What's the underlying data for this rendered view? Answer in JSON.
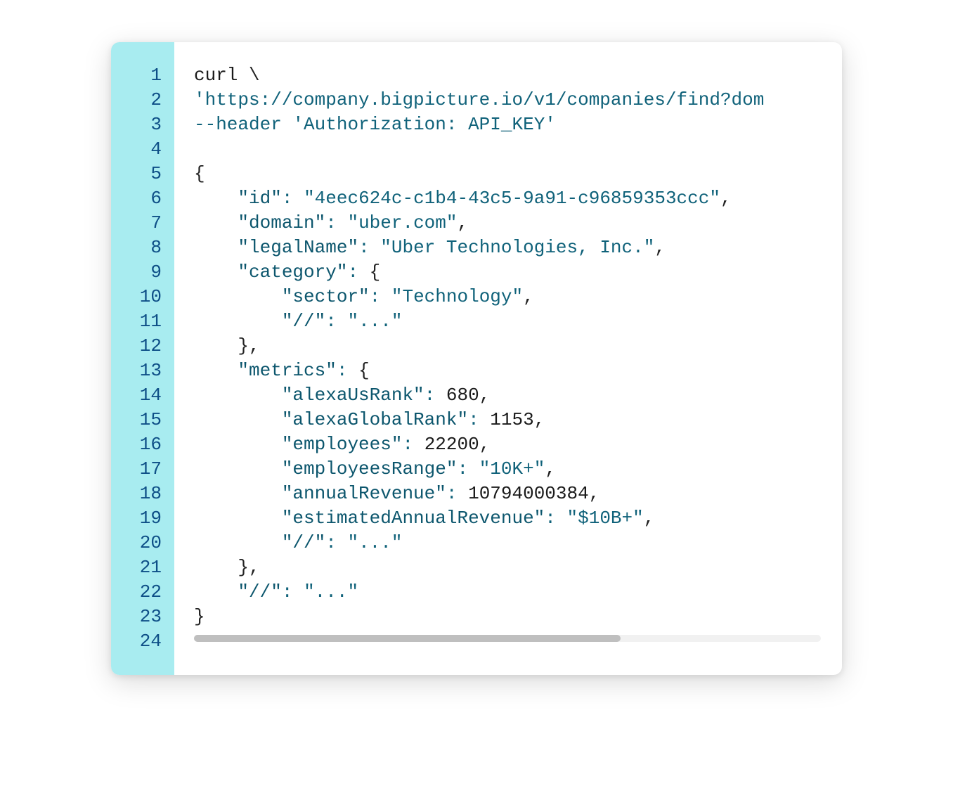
{
  "lineCount": 24,
  "scrollbar": {
    "thumbWidthPercent": "68%"
  },
  "code": {
    "l1": {
      "cmd": "curl",
      "bs": "\\"
    },
    "l2": {
      "url": "'https://company.bigpicture.io/v1/companies/find?dom"
    },
    "l3": {
      "opt": "--header",
      "arg": "'Authorization: API_KEY'"
    },
    "l4": {
      "blank": ""
    },
    "l5": {
      "open": "{"
    },
    "l6": {
      "key": "\"id\"",
      "colon": ":",
      "val": "\"4eec624c-c1b4-43c5-9a91-c96859353ccc\"",
      "comma": ","
    },
    "l7": {
      "key": "\"domain\"",
      "colon": ":",
      "val": "\"uber.com\"",
      "comma": ","
    },
    "l8": {
      "key": "\"legalName\"",
      "colon": ":",
      "val": "\"Uber Technologies, Inc.\"",
      "comma": ","
    },
    "l9": {
      "key": "\"category\"",
      "colon": ":",
      "brace": "{"
    },
    "l10": {
      "key": "\"sector\"",
      "colon": ":",
      "val": "\"Technology\"",
      "comma": ","
    },
    "l11": {
      "key": "\"//\"",
      "colon": ":",
      "val": "\"...\""
    },
    "l12": {
      "brace": "}",
      "comma": ","
    },
    "l13": {
      "key": "\"metrics\"",
      "colon": ":",
      "brace": "{"
    },
    "l14": {
      "key": "\"alexaUsRank\"",
      "colon": ":",
      "num": "680",
      "comma": ","
    },
    "l15": {
      "key": "\"alexaGlobalRank\"",
      "colon": ":",
      "num": "1153",
      "comma": ","
    },
    "l16": {
      "key": "\"employees\"",
      "colon": ":",
      "num": "22200",
      "comma": ","
    },
    "l17": {
      "key": "\"employeesRange\"",
      "colon": ":",
      "val": "\"10K+\"",
      "comma": ","
    },
    "l18": {
      "key": "\"annualRevenue\"",
      "colon": ":",
      "num": "10794000384",
      "comma": ","
    },
    "l19": {
      "key": "\"estimatedAnnualRevenue\"",
      "colon": ":",
      "val": "\"$10B+\"",
      "comma": ","
    },
    "l20": {
      "key": "\"//\"",
      "colon": ":",
      "val": "\"...\""
    },
    "l21": {
      "brace": "}",
      "comma": ","
    },
    "l22": {
      "key": "\"//\"",
      "colon": ":",
      "val": "\"...\""
    },
    "l23": {
      "close": "}"
    },
    "l24": {
      "blank": ""
    }
  }
}
